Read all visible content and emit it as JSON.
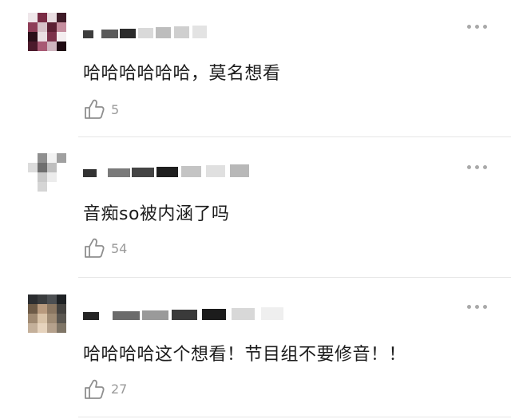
{
  "comments": [
    {
      "text": "哈哈哈哈哈哈，莫名想看",
      "likes": "5",
      "avatar_colors": [
        "#efe7ea",
        "#7a2c45",
        "#e9dde1",
        "#3f1b27",
        "#8e3e58",
        "#d7c2c9",
        "#5c1f33",
        "#c58d9e",
        "#2a0f19",
        "#eadfe3",
        "#7c324b",
        "#f4eef0",
        "#4b1a2b",
        "#a85a74",
        "#cfb5bf",
        "#1f0a12"
      ],
      "name_blur_colors": [
        "#3d3d3d",
        "#5a5a5a",
        "#2b2b2b",
        "#d9d9d9",
        "#bdbdbd",
        "#cfcfcf",
        "#e3e3e3"
      ]
    },
    {
      "text": "音痴so被内涵了吗",
      "likes": "54",
      "avatar_colors": [
        "#ffffff",
        "#8f8f8f",
        "#f2f2f2",
        "#a0a0a0",
        "#dcdcdc",
        "#6e6e6e",
        "#bfbfbf",
        "#ffffff",
        "#ffffff",
        "#c9c9c9",
        "#ececec",
        "#ffffff",
        "#ffffff",
        "#d5d5d5",
        "#ffffff",
        "#ffffff"
      ],
      "name_blur_colors": [
        "#333333",
        "#7a7a7a",
        "#444444",
        "#1f1f1f",
        "#c4c4c4",
        "#e0e0e0",
        "#b8b8b8"
      ]
    },
    {
      "text": "哈哈哈哈这个想看！节目组不要修音！！",
      "likes": "27",
      "avatar_colors": [
        "#2b2d30",
        "#3a3c3e",
        "#4c4f52",
        "#1e2124",
        "#6e5b47",
        "#b89a7e",
        "#8a7661",
        "#44423f",
        "#a08a72",
        "#d8c2a7",
        "#9f8b74",
        "#5a5650",
        "#c4b09a",
        "#e6d3bd",
        "#b5a18c",
        "#7f7566"
      ],
      "name_blur_colors": [
        "#252525",
        "#6b6b6b",
        "#9a9a9a",
        "#3a3a3a",
        "#1c1c1c",
        "#d8d8d8",
        "#efefef"
      ]
    }
  ],
  "colors": {
    "text": "#1c1c1c",
    "muted": "#9a9a9a",
    "divider": "#e6e6e6",
    "more_dots": "#a9a9a9"
  },
  "icons": {
    "like": "thumbs-up-outline-icon",
    "more": "more-horizontal-icon"
  }
}
